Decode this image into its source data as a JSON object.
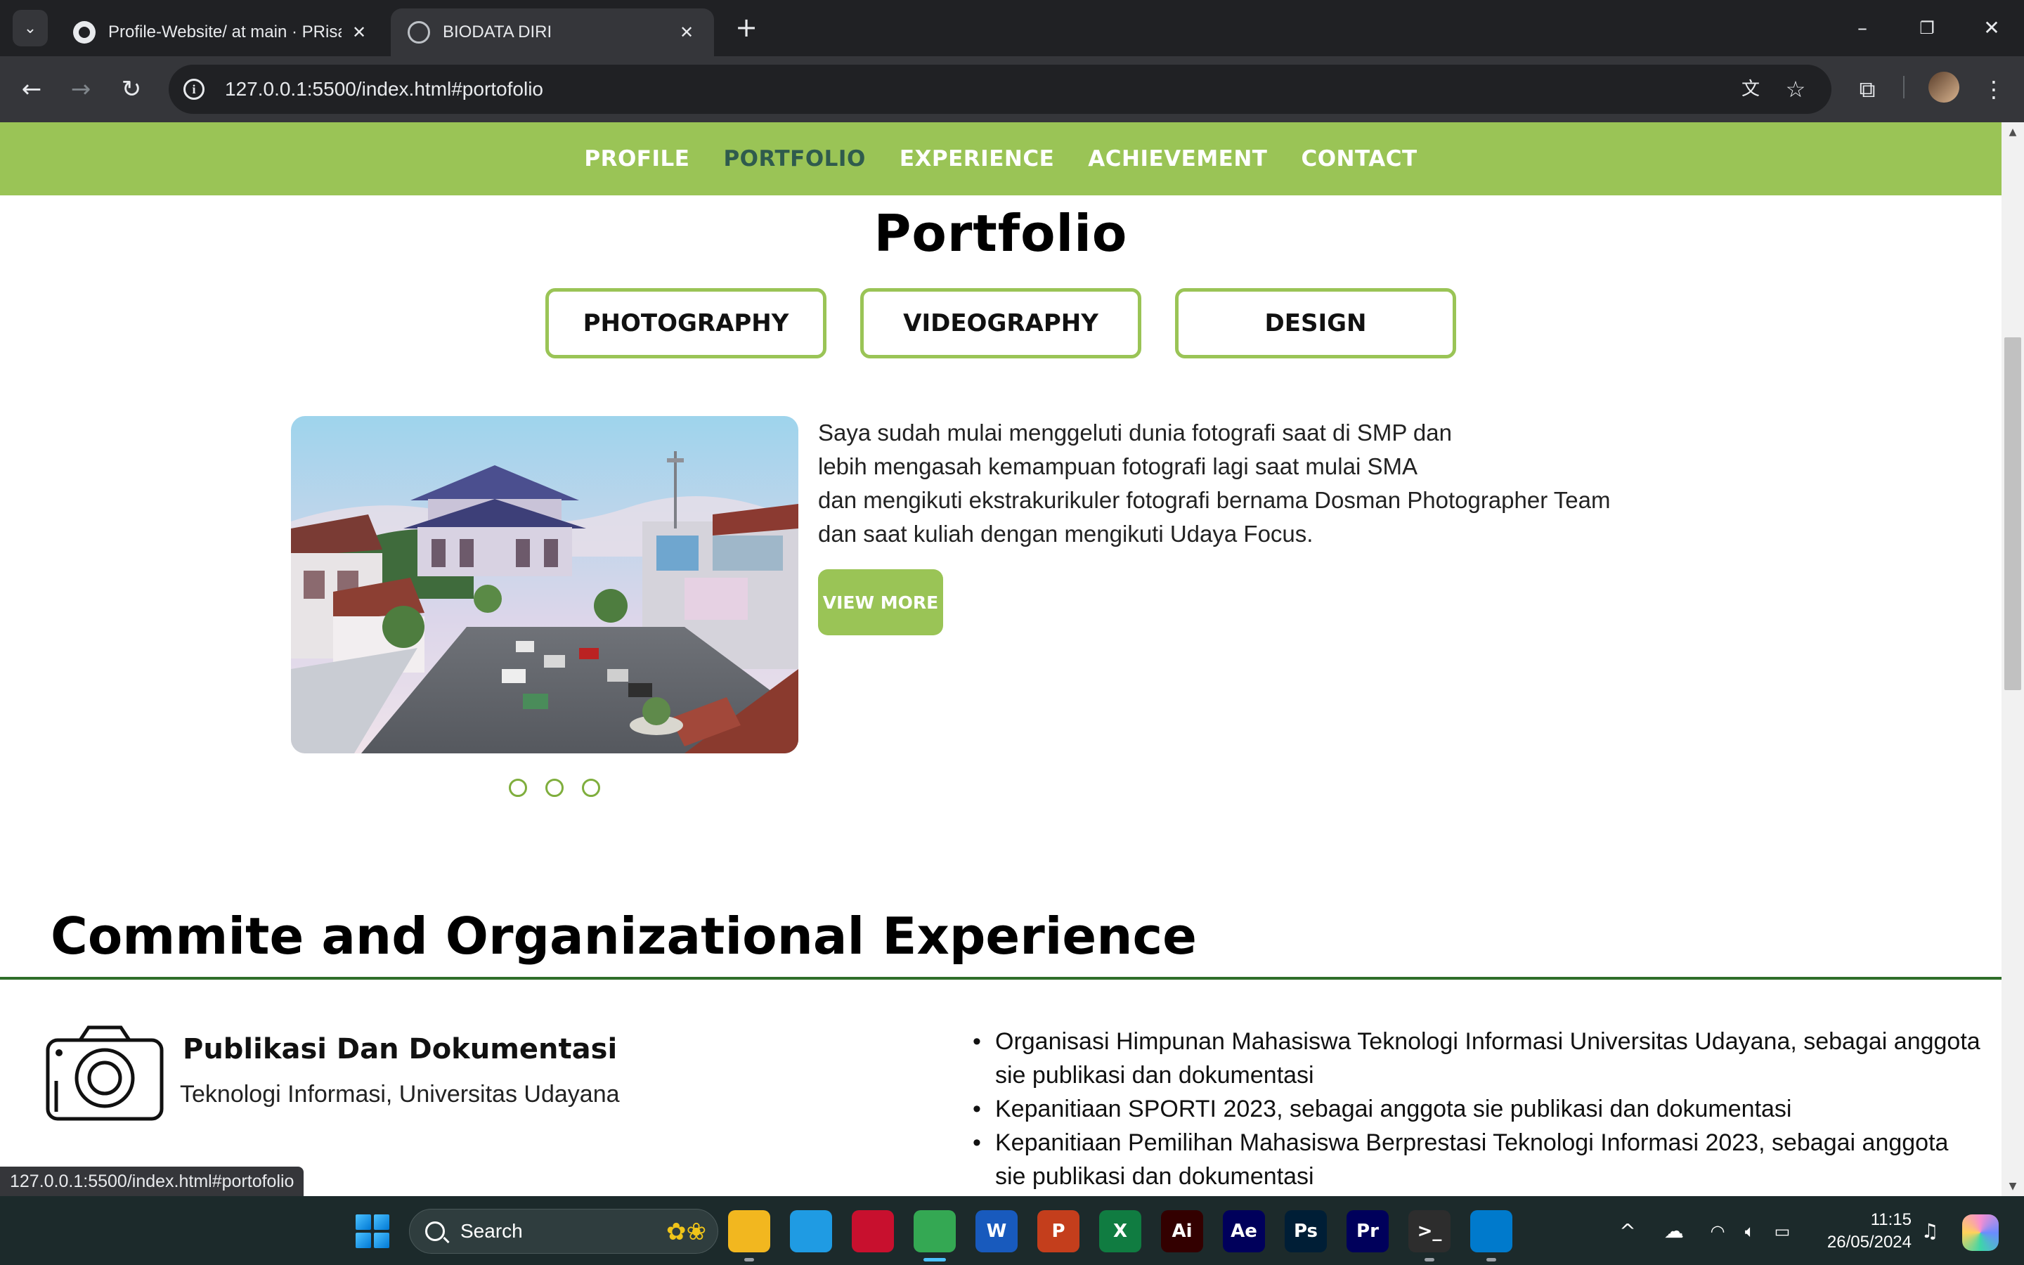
{
  "browser": {
    "tabs": [
      {
        "title": "Profile-Website/ at main · PRisal",
        "icon": "github-icon"
      },
      {
        "title": "BIODATA DIRI",
        "icon": "globe-icon"
      }
    ],
    "url": "127.0.0.1:5500/index.html#portofolio",
    "status_url": "127.0.0.1:5500/index.html#portofolio"
  },
  "site_nav": {
    "items": [
      "PROFILE",
      "PORTFOLIO",
      "EXPERIENCE",
      "ACHIEVEMENT",
      "CONTACT"
    ],
    "current": "PORTFOLIO"
  },
  "portfolio": {
    "title": "Portfolio",
    "categories": [
      "PHOTOGRAPHY",
      "VIDEOGRAPHY",
      "DESIGN"
    ],
    "description_lines": [
      "Saya sudah mulai menggeluti dunia fotografi saat di SMP dan",
      "lebih mengasah kemampuan fotografi lagi saat mulai SMA",
      "dan mengikuti ekstrakurikuler fotografi bernama Dosman Photographer Team",
      "dan saat kuliah dengan mengikuti Udaya Focus."
    ],
    "view_more": "VIEW MORE",
    "slide_count": 3
  },
  "experience": {
    "title": "Commite and Organizational Experience",
    "role": "Publikasi Dan Dokumentasi",
    "org": "Teknologi Informasi, Universitas Udayana",
    "items": [
      "Organisasi Himpunan Mahasiswa Teknologi Informasi Universitas Udayana, sebagai anggota sie publikasi dan dokumentasi",
      "Kepanitiaan SPORTI 2023, sebagai anggota sie publikasi dan dokumentasi",
      "Kepanitiaan Pemilihan Mahasiswa Berprestasi Teknologi Informasi 2023, sebagai anggota sie publikasi dan dokumentasi"
    ]
  },
  "taskbar": {
    "search": "Search",
    "apps": [
      {
        "name": "file-explorer-icon",
        "label": "",
        "color": "#f2b71f"
      },
      {
        "name": "edge-icon",
        "label": "",
        "color": "#1f9be3"
      },
      {
        "name": "mcafee-icon",
        "label": "",
        "color": "#c8102e"
      },
      {
        "name": "chrome-icon",
        "label": "",
        "color": "#34a853"
      },
      {
        "name": "word-icon",
        "label": "W",
        "color": "#185abd"
      },
      {
        "name": "powerpoint-icon",
        "label": "P",
        "color": "#c43e1c"
      },
      {
        "name": "excel-icon",
        "label": "X",
        "color": "#107c41"
      },
      {
        "name": "illustrator-icon",
        "label": "Ai",
        "color": "#330000"
      },
      {
        "name": "after-effects-icon",
        "label": "Ae",
        "color": "#00005b"
      },
      {
        "name": "photoshop-icon",
        "label": "Ps",
        "color": "#001e36"
      },
      {
        "name": "premiere-icon",
        "label": "Pr",
        "color": "#00005b"
      },
      {
        "name": "terminal-icon",
        "label": ">_",
        "color": "#2d2d2d"
      },
      {
        "name": "vscode-icon",
        "label": "",
        "color": "#007acc"
      }
    ],
    "time": "11:15",
    "date": "26/05/2024"
  },
  "colors": {
    "accent_green": "#9ac456",
    "nav_active": "#2f5b4d",
    "rule_green": "#2f6e2a"
  }
}
